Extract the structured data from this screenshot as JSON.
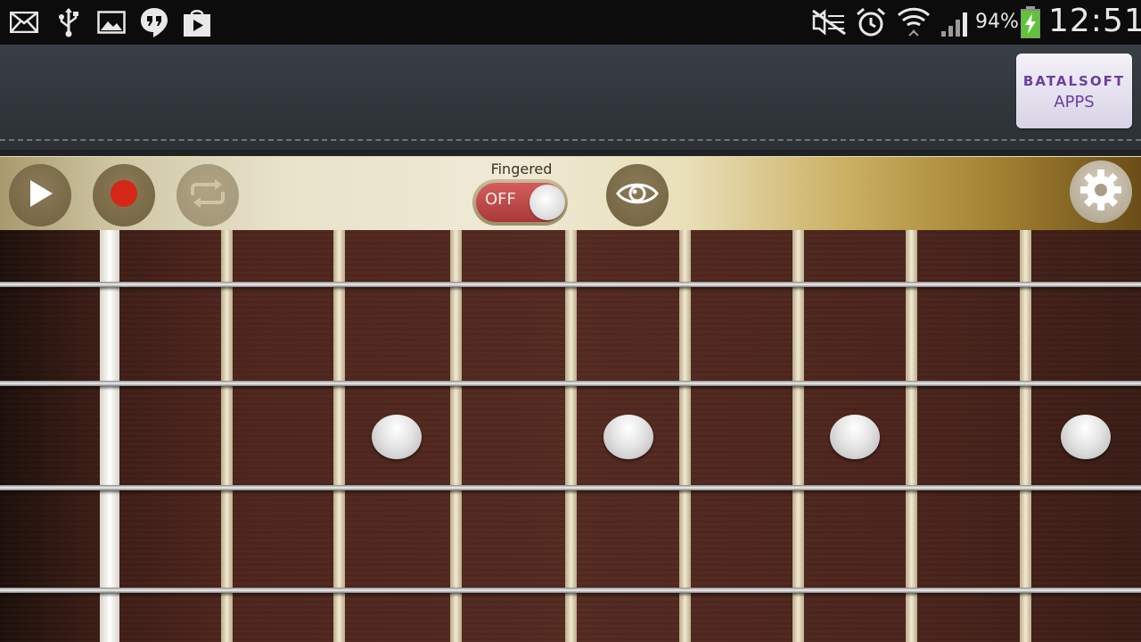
{
  "status_bar": {
    "icons": [
      "mail-icon",
      "usb-icon",
      "image-icon",
      "hangouts-icon",
      "play-store-icon",
      "mute-icon",
      "alarm-icon",
      "wifi-icon",
      "signal-icon",
      "battery-charging-icon"
    ],
    "battery_percent": "94%",
    "time": "12:51"
  },
  "ad": {
    "line1": "BATALSOFT",
    "line2": "APPS"
  },
  "toolbar": {
    "fingered_label": "Fingered",
    "toggle_state": "OFF",
    "buttons": [
      "play-icon",
      "record-icon",
      "loop-icon",
      "eye-icon",
      "gear-icon"
    ],
    "colors": {
      "record": "#d42718",
      "toggle_off": "#c04545"
    }
  },
  "fretboard": {
    "strings": 4,
    "frets": 9,
    "inlay_markers": 4
  }
}
